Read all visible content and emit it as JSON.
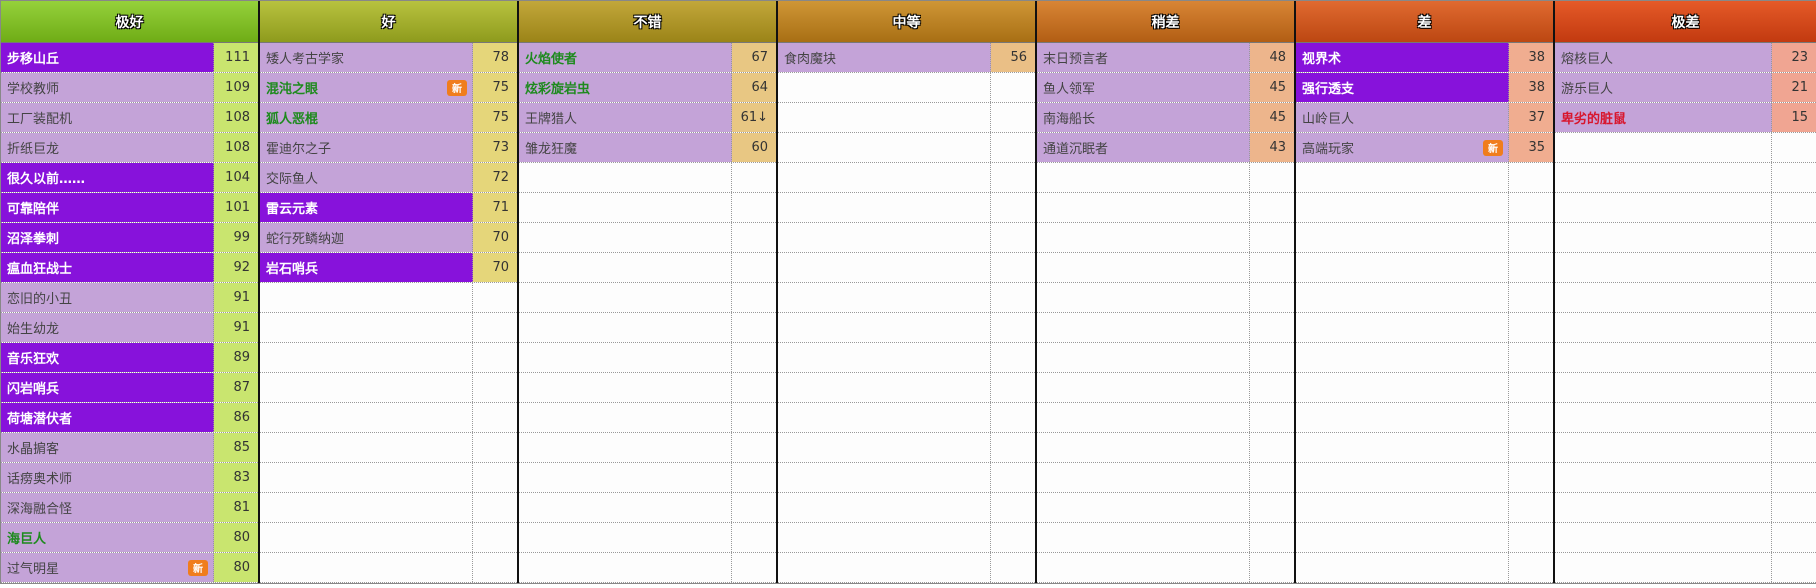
{
  "tiers": [
    {
      "label": "极好",
      "header_colors": [
        "#95d13b",
        "#6fac16"
      ],
      "score_bg": "#c9e56f",
      "cards": [
        {
          "name": "步移山丘",
          "score": "111",
          "style": "hl"
        },
        {
          "name": "学校教师",
          "score": "109",
          "style": "normal"
        },
        {
          "name": "工厂装配机",
          "score": "108",
          "style": "normal"
        },
        {
          "name": "折纸巨龙",
          "score": "108",
          "style": "normal"
        },
        {
          "name": "很久以前……",
          "score": "104",
          "style": "hl"
        },
        {
          "name": "可靠陪伴",
          "score": "101",
          "style": "hl"
        },
        {
          "name": "沼泽拳刺",
          "score": "99",
          "style": "hl"
        },
        {
          "name": "瘟血狂战士",
          "score": "92",
          "style": "hl"
        },
        {
          "name": "恋旧的小丑",
          "score": "91",
          "style": "normal"
        },
        {
          "name": "始生幼龙",
          "score": "91",
          "style": "normal"
        },
        {
          "name": "音乐狂欢",
          "score": "89",
          "style": "hl"
        },
        {
          "name": "闪岩哨兵",
          "score": "87",
          "style": "hl"
        },
        {
          "name": "荷塘潜伏者",
          "score": "86",
          "style": "hl"
        },
        {
          "name": "水晶掮客",
          "score": "85",
          "style": "normal"
        },
        {
          "name": "话痨奥术师",
          "score": "83",
          "style": "normal"
        },
        {
          "name": "深海融合怪",
          "score": "81",
          "style": "normal"
        },
        {
          "name": "海巨人",
          "score": "80",
          "style": "green"
        },
        {
          "name": "过气明星",
          "score": "80",
          "style": "normal",
          "badge": "新"
        }
      ]
    },
    {
      "label": "好",
      "header_colors": [
        "#b8c23f",
        "#8e9b1d"
      ],
      "score_bg": "#e5d67a",
      "cards": [
        {
          "name": "矮人考古学家",
          "score": "78",
          "style": "normal"
        },
        {
          "name": "混沌之眼",
          "score": "75",
          "style": "green",
          "badge": "新"
        },
        {
          "name": "狐人恶棍",
          "score": "75",
          "style": "green"
        },
        {
          "name": "霍迪尔之子",
          "score": "73",
          "style": "normal"
        },
        {
          "name": "交际鱼人",
          "score": "72",
          "style": "normal"
        },
        {
          "name": "雷云元素",
          "score": "71",
          "style": "hl"
        },
        {
          "name": "蛇行死鳞纳迦",
          "score": "70",
          "style": "normal"
        },
        {
          "name": "岩石哨兵",
          "score": "70",
          "style": "hl"
        }
      ]
    },
    {
      "label": "不错",
      "header_colors": [
        "#c2a73a",
        "#9b8418"
      ],
      "score_bg": "#e8c783",
      "cards": [
        {
          "name": "火焰使者",
          "score": "67",
          "style": "green"
        },
        {
          "name": "炫彩旋岩虫",
          "score": "64",
          "style": "green"
        },
        {
          "name": "王牌猎人",
          "score": "61↓",
          "style": "normal"
        },
        {
          "name": "雏龙狂魔",
          "score": "60",
          "style": "normal"
        }
      ]
    },
    {
      "label": "中等",
      "header_colors": [
        "#cf9636",
        "#a86f14"
      ],
      "score_bg": "#eabf86",
      "cards": [
        {
          "name": "食肉魔块",
          "score": "56",
          "style": "normal"
        }
      ]
    },
    {
      "label": "稍差",
      "header_colors": [
        "#d88535",
        "#b25e14"
      ],
      "score_bg": "#edb58c",
      "cards": [
        {
          "name": "末日预言者",
          "score": "48",
          "style": "normal"
        },
        {
          "name": "鱼人领军",
          "score": "45",
          "style": "normal"
        },
        {
          "name": "南海船长",
          "score": "45",
          "style": "normal"
        },
        {
          "name": "通道沉眠者",
          "score": "43",
          "style": "normal"
        }
      ]
    },
    {
      "label": "差",
      "header_colors": [
        "#e06a30",
        "#bc4712"
      ],
      "score_bg": "#f0ad90",
      "cards": [
        {
          "name": "视界术",
          "score": "38",
          "style": "hl"
        },
        {
          "name": "强行透支",
          "score": "38",
          "style": "hl"
        },
        {
          "name": "山岭巨人",
          "score": "37",
          "style": "normal"
        },
        {
          "name": "高端玩家",
          "score": "35",
          "style": "normal",
          "badge": "新"
        }
      ]
    },
    {
      "label": "极差",
      "header_colors": [
        "#e55a28",
        "#c23a10"
      ],
      "score_bg": "#f0a592",
      "cards": [
        {
          "name": "熔核巨人",
          "score": "23",
          "style": "normal"
        },
        {
          "name": "游乐巨人",
          "score": "21",
          "style": "normal"
        },
        {
          "name": "卑劣的脏鼠",
          "score": "15",
          "style": "red"
        }
      ]
    }
  ],
  "total_rows": 18
}
